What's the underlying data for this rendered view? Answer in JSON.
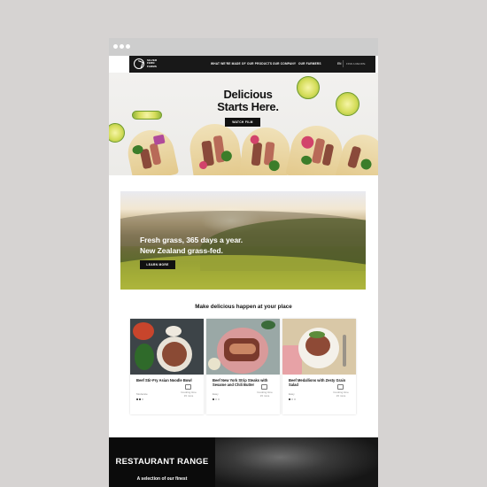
{
  "browser": {
    "chrome_dots": 3
  },
  "nav": {
    "logo_text": "SILVER FERN FARMS",
    "items": [
      "WHAT WE'RE MADE OF",
      "OUR PRODUCTS",
      "OUR COMPANY",
      "OUR FARMERS"
    ],
    "language": "EN",
    "search_label": "FIND A RECIPE"
  },
  "hero": {
    "title_line1": "Delicious",
    "title_line2": "Starts Here.",
    "cta_label": "WATCH FILM"
  },
  "promo": {
    "line1": "Fresh grass, 365 days a year.",
    "line2": "New Zealand grass-fed.",
    "cta_label": "LEARN MORE"
  },
  "recipes": {
    "heading": "Make delicious happen at your place",
    "cards": [
      {
        "title": "Beef Stir-Fry Asian Noodle Bowl",
        "difficulty": "Moderate",
        "difficulty_level": 2,
        "cook_line1": "Cooking time",
        "cook_line2": "15 mins"
      },
      {
        "title": "Beef New York Strip Steaks with Sesame and Chili Butter",
        "difficulty": "Easy",
        "difficulty_level": 1,
        "cook_line1": "Cooking time",
        "cook_line2": "15 mins"
      },
      {
        "title": "Beef Medallions with Zesty Grain Salad",
        "difficulty": "Easy",
        "difficulty_level": 1,
        "cook_line1": "Cooking time",
        "cook_line2": "15 mins"
      }
    ]
  },
  "restaurant": {
    "title": "RESTAURANT RANGE",
    "subtitle": "A selection of our finest"
  },
  "colors": {
    "page_background": "#d6d3d2",
    "nav_background": "#181818",
    "button_background": "#111111",
    "accent_green": "#8e9a2e"
  }
}
